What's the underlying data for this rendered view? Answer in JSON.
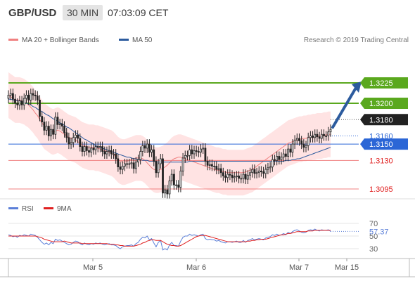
{
  "header": {
    "symbol": "GBP/USD",
    "interval": "30 MIN",
    "time": "07:03:09 CET"
  },
  "legend": {
    "items": [
      {
        "label": "MA 20 + Bollinger Bands",
        "color": "#f08080"
      },
      {
        "label": "MA 50",
        "color": "#2c5b9e"
      }
    ],
    "credit": "Research © 2019 Trading Central"
  },
  "rsi_legend": {
    "items": [
      {
        "label": "RSI",
        "color": "#5b7fd8"
      },
      {
        "label": "9MA",
        "color": "#e02020"
      }
    ]
  },
  "colors": {
    "support_resistance_green": "#5aa81e",
    "pivot_blue": "#2b66d6",
    "support_red": "#f08080",
    "arrow_blue": "#2c5b9e",
    "band_fill": "#ffe3e3",
    "candle_up": "#ffffff",
    "candle_down": "#222222",
    "rsi_line": "#5b7fd8",
    "rsi_ma": "#e02020"
  },
  "chart_data": [
    {
      "type": "candlestick",
      "x_labels": [
        "Mar 5",
        "Mar 6",
        "Mar 7",
        "Mar 15"
      ],
      "ylim": [
        1.308,
        1.325
      ],
      "current_price": "1.3180",
      "levels": [
        {
          "label": "1.3225",
          "value": 1.3225,
          "kind": "resistance",
          "color": "#5aa81e",
          "style": "badge"
        },
        {
          "label": "1.3200",
          "value": 1.32,
          "kind": "resistance",
          "color": "#5aa81e",
          "style": "badge"
        },
        {
          "label": "1.3180",
          "value": 1.318,
          "kind": "price",
          "color": "#222222",
          "style": "badge"
        },
        {
          "label": "1.3160",
          "value": 1.316,
          "kind": "reference",
          "color": "#2b66d6",
          "style": "text"
        },
        {
          "label": "1.3150",
          "value": 1.315,
          "kind": "pivot",
          "color": "#2b66d6",
          "style": "badge"
        },
        {
          "label": "1.3130",
          "value": 1.313,
          "kind": "support",
          "color": "#e02020",
          "style": "text"
        },
        {
          "label": "1.3095",
          "value": 1.3095,
          "kind": "support",
          "color": "#e02020",
          "style": "text"
        }
      ],
      "closes": [
        1.321,
        1.3212,
        1.3205,
        1.32,
        1.3198,
        1.3203,
        1.3198,
        1.3206,
        1.321,
        1.3204,
        1.3212,
        1.321,
        1.3209,
        1.3204,
        1.3184,
        1.3177,
        1.3167,
        1.3172,
        1.316,
        1.3168,
        1.3162,
        1.3183,
        1.3174,
        1.3175,
        1.3172,
        1.3164,
        1.3158,
        1.315,
        1.3152,
        1.3158,
        1.3161,
        1.3157,
        1.3147,
        1.3141,
        1.3147,
        1.3142,
        1.314,
        1.3145,
        1.3143,
        1.3147,
        1.3146,
        1.3147,
        1.3141,
        1.3138,
        1.3141,
        1.3142,
        1.3138,
        1.3138,
        1.3132,
        1.3122,
        1.3119,
        1.3123,
        1.3126,
        1.3126,
        1.3126,
        1.3127,
        1.312,
        1.3128,
        1.3131,
        1.3141,
        1.3148,
        1.3145,
        1.315,
        1.314,
        1.3143,
        1.3129,
        1.3115,
        1.3126,
        1.3132,
        1.309,
        1.3094,
        1.3089,
        1.3105,
        1.3113,
        1.31,
        1.31,
        1.3097,
        1.3117,
        1.3133,
        1.3136,
        1.3136,
        1.3143,
        1.3138,
        1.3142,
        1.3141,
        1.314,
        1.3144,
        1.3145,
        1.3129,
        1.3124,
        1.3125,
        1.3123,
        1.3123,
        1.3119,
        1.312,
        1.3115,
        1.3111,
        1.3109,
        1.3113,
        1.3112,
        1.3109,
        1.311,
        1.3111,
        1.3108,
        1.3108,
        1.3113,
        1.3107,
        1.3112,
        1.3115,
        1.3119,
        1.3114,
        1.3115,
        1.3117,
        1.3116,
        1.3114,
        1.3119,
        1.3121,
        1.3122,
        1.3131,
        1.313,
        1.3135,
        1.3131,
        1.3134,
        1.3138,
        1.3135,
        1.3144,
        1.314,
        1.315,
        1.3155,
        1.3157,
        1.3154,
        1.315,
        1.3146,
        1.3148,
        1.3158,
        1.316,
        1.3158,
        1.3162,
        1.3159,
        1.3157,
        1.3162,
        1.316,
        1.316,
        1.3165,
        1.3168
      ],
      "ma20": [
        1.321,
        1.3208,
        1.3206,
        1.3204,
        1.3204,
        1.3204,
        1.3203,
        1.3202,
        1.32,
        1.3198,
        1.3195,
        1.3192,
        1.3188,
        1.3185,
        1.318,
        1.3176,
        1.3172,
        1.317,
        1.3168,
        1.3166,
        1.3165,
        1.3166,
        1.3167,
        1.3166,
        1.3164,
        1.3162,
        1.316,
        1.3158,
        1.3157,
        1.3156,
        1.3155,
        1.3153,
        1.3151,
        1.3149,
        1.3148,
        1.3147,
        1.3146,
        1.3146,
        1.3146,
        1.3145,
        1.3145,
        1.3144,
        1.3143,
        1.3142,
        1.3141,
        1.314,
        1.3139,
        1.3137,
        1.3134,
        1.3131,
        1.3129,
        1.3128,
        1.3128,
        1.3129,
        1.313,
        1.3131,
        1.3132,
        1.3133,
        1.3133,
        1.3133,
        1.3132,
        1.313,
        1.3127,
        1.3124,
        1.3121,
        1.3119,
        1.3118,
        1.3118,
        1.3119,
        1.312,
        1.3122,
        1.3124,
        1.3127,
        1.313,
        1.3132,
        1.3133,
        1.3134,
        1.3134,
        1.3133,
        1.3132,
        1.3131,
        1.313,
        1.3129,
        1.3128,
        1.3127,
        1.3126,
        1.3125,
        1.3124,
        1.3123,
        1.3122,
        1.3121,
        1.312,
        1.3119,
        1.3118,
        1.3118,
        1.3117,
        1.3116,
        1.3116,
        1.3115,
        1.3115,
        1.3115,
        1.3115,
        1.3115,
        1.3115,
        1.3115,
        1.3115,
        1.3116,
        1.3117,
        1.3118,
        1.3119,
        1.3121,
        1.3123,
        1.3125,
        1.3127,
        1.3129,
        1.3131,
        1.3133,
        1.3135,
        1.3137,
        1.3139,
        1.3141,
        1.3143,
        1.3145,
        1.3147,
        1.3149,
        1.3151,
        1.3152,
        1.3153,
        1.3154,
        1.3155,
        1.3156,
        1.3156,
        1.3157,
        1.3157,
        1.3158,
        1.3158,
        1.3159,
        1.3159,
        1.316,
        1.316,
        1.316,
        1.3161,
        1.3161,
        1.3162,
        1.3162
      ],
      "ma50": [
        1.3205,
        1.3205,
        1.3204,
        1.3204,
        1.3203,
        1.3203,
        1.3202,
        1.3201,
        1.32,
        1.3199,
        1.3198,
        1.3196,
        1.3195,
        1.3193,
        1.3191,
        1.319,
        1.3188,
        1.3186,
        1.3185,
        1.3183,
        1.3181,
        1.318,
        1.3178,
        1.3176,
        1.3175,
        1.3173,
        1.3171,
        1.317,
        1.3168,
        1.3166,
        1.3164,
        1.3162,
        1.316,
        1.3158,
        1.3156,
        1.3155,
        1.3153,
        1.3152,
        1.315,
        1.3148,
        1.3147,
        1.3146,
        1.3145,
        1.3144,
        1.3143,
        1.3142,
        1.3141,
        1.314,
        1.3139,
        1.3138,
        1.3137,
        1.3136,
        1.3135,
        1.3134,
        1.3134,
        1.3133,
        1.3132,
        1.3132,
        1.3131,
        1.3131,
        1.313,
        1.313,
        1.313,
        1.3129,
        1.3129,
        1.3129,
        1.3128,
        1.3128,
        1.3128,
        1.3128,
        1.3128,
        1.3128,
        1.3128,
        1.3128,
        1.3128,
        1.3128,
        1.3128,
        1.3128,
        1.3128,
        1.3128,
        1.3128,
        1.3129,
        1.3129,
        1.3129,
        1.3129,
        1.3129,
        1.3129,
        1.3129,
        1.3129,
        1.3129,
        1.3129,
        1.3129,
        1.3129,
        1.3129,
        1.3129,
        1.3129,
        1.3129,
        1.3129,
        1.3129,
        1.3129,
        1.3129,
        1.3129,
        1.3129,
        1.3129,
        1.3129,
        1.3129,
        1.3129,
        1.3129,
        1.3129,
        1.3129,
        1.3129,
        1.3129,
        1.3129,
        1.3129,
        1.3129,
        1.3129,
        1.3129,
        1.3129,
        1.3129,
        1.3129,
        1.3129,
        1.3129,
        1.3129,
        1.3129,
        1.313,
        1.313,
        1.313,
        1.3131,
        1.3131,
        1.3132,
        1.3132,
        1.3133,
        1.3134,
        1.3135,
        1.3136,
        1.3137,
        1.3138,
        1.3139,
        1.314,
        1.3141,
        1.3142,
        1.3143,
        1.3144,
        1.3145,
        1.3146
      ],
      "band_width": 0.0028,
      "forecast_target": 1.3225
    },
    {
      "type": "line",
      "name_labels": [
        "RSI",
        "9MA"
      ],
      "yticks": [
        "70",
        "50",
        "30"
      ],
      "ylim": [
        20,
        80
      ],
      "current_value": "57.37",
      "rsi": [
        52,
        51,
        49,
        50,
        48,
        51,
        50,
        52,
        51,
        50,
        53,
        52,
        51,
        48,
        44,
        40,
        37,
        39,
        36,
        40,
        38,
        45,
        43,
        44,
        42,
        40,
        38,
        36,
        37,
        40,
        42,
        41,
        38,
        36,
        39,
        37,
        36,
        38,
        37,
        39,
        38,
        39,
        37,
        36,
        37,
        38,
        36,
        36,
        35,
        32,
        30,
        33,
        34,
        35,
        35,
        36,
        34,
        38,
        40,
        45,
        48,
        47,
        50,
        44,
        46,
        39,
        33,
        40,
        43,
        28,
        30,
        28,
        36,
        40,
        35,
        35,
        34,
        42,
        48,
        50,
        50,
        53,
        51,
        52,
        51,
        50,
        52,
        53,
        46,
        44,
        45,
        44,
        44,
        42,
        43,
        41,
        40,
        39,
        41,
        41,
        40,
        41,
        42,
        40,
        40,
        43,
        40,
        43,
        44,
        46,
        44,
        45,
        46,
        45,
        44,
        47,
        48,
        49,
        52,
        51,
        53,
        51,
        52,
        54,
        52,
        56,
        54,
        57,
        59,
        60,
        58,
        56,
        55,
        56,
        59,
        60,
        59,
        61,
        59,
        58,
        60,
        59,
        59,
        60,
        57.37
      ],
      "ma9": [
        50,
        50,
        50,
        50,
        50,
        50,
        50,
        50,
        50,
        50,
        50,
        50,
        50,
        49,
        48,
        47,
        45,
        44,
        43,
        42,
        41,
        41,
        41,
        41,
        41,
        42,
        41,
        40,
        39,
        39,
        39,
        39,
        39,
        38,
        38,
        38,
        38,
        38,
        38,
        38,
        38,
        38,
        38,
        38,
        38,
        37,
        37,
        37,
        36,
        36,
        35,
        35,
        34,
        34,
        34,
        34,
        34,
        35,
        36,
        37,
        39,
        40,
        42,
        43,
        44,
        44,
        43,
        43,
        43,
        41,
        39,
        37,
        36,
        35,
        35,
        34,
        34,
        35,
        37,
        39,
        41,
        43,
        45,
        47,
        49,
        50,
        51,
        51,
        51,
        50,
        49,
        48,
        47,
        46,
        45,
        44,
        43,
        42,
        41,
        41,
        41,
        41,
        41,
        41,
        41,
        41,
        41,
        42,
        42,
        43,
        43,
        44,
        44,
        45,
        45,
        45,
        46,
        47,
        48,
        49,
        50,
        51,
        52,
        52,
        53,
        54,
        54,
        55,
        56,
        57,
        57,
        57,
        57,
        57,
        58,
        58,
        58,
        59,
        59,
        59,
        59,
        59,
        59,
        59,
        59
      ]
    }
  ]
}
